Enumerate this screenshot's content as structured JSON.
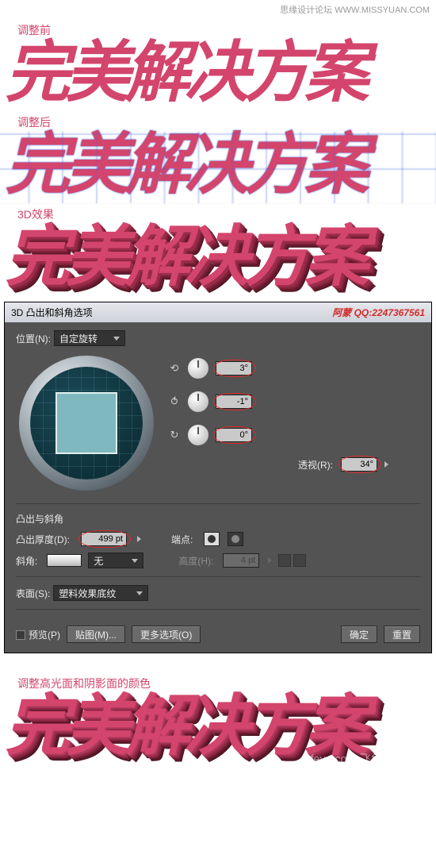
{
  "watermark_top": "思缘设计论坛  WWW.MISSYUAN.COM",
  "labels": {
    "before": "调整前",
    "after": "调整后",
    "threeD": "3D效果",
    "colorAdjust": "调整高光面和阴影面的颜色"
  },
  "headline": "完美解决方案",
  "watermark_bottom": "feye.com 飞鱼教程网",
  "dialog": {
    "title": "3D 凸出和斜角选项",
    "credit": "阿蒙 QQ:2247367561",
    "position_label": "位置(N):",
    "position_value": "自定旋转",
    "angles": {
      "x": "3°",
      "y": "-1°",
      "z": "0°"
    },
    "perspective_label": "透视(R):",
    "perspective_value": "34°",
    "extrude_group_title": "凸出与斜角",
    "depth_label": "凸出厚度(D):",
    "depth_value": "499 pt",
    "cap_label": "端点:",
    "bevel_label": "斜角:",
    "bevel_value": "无",
    "height_label": "高度(H):",
    "height_value": "4 pt",
    "surface_label": "表面(S):",
    "surface_value": "塑料效果底纹",
    "preview_label": "预览(P)",
    "buttons": {
      "map": "贴图(M)...",
      "more": "更多选项(O)",
      "ok": "确定",
      "reset": "重置"
    }
  }
}
